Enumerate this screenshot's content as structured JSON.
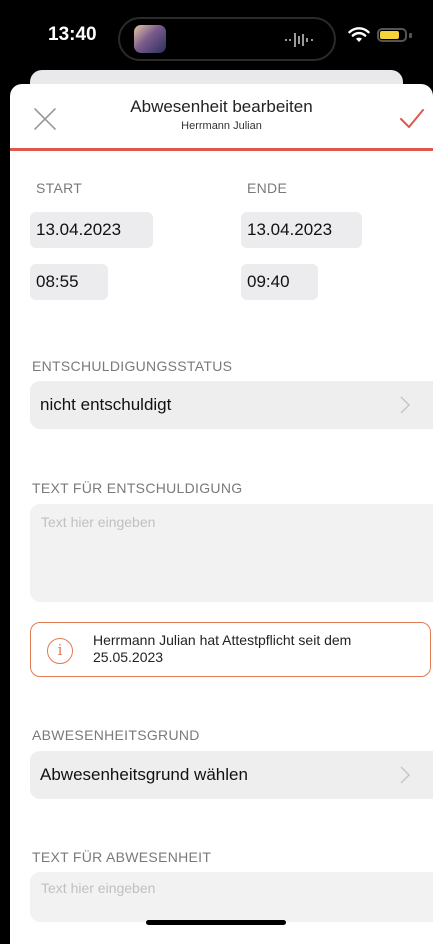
{
  "status_bar": {
    "time": "13:40"
  },
  "nav": {
    "title": "Abwesenheit bearbeiten",
    "subtitle": "Herrmann Julian"
  },
  "colors": {
    "accent": "#e0584c",
    "info_border": "#e07b54",
    "battery": "#f5d33a"
  },
  "start": {
    "label": "START",
    "date": "13.04.2023",
    "time": "08:55"
  },
  "end": {
    "label": "ENDE",
    "date": "13.04.2023",
    "time": "09:40"
  },
  "excuse_status": {
    "label": "ENTSCHULDIGUNGSSTATUS",
    "value": "nicht entschuldigt"
  },
  "excuse_text": {
    "label": "TEXT FÜR ENTSCHULDIGUNG",
    "placeholder": "Text hier eingeben"
  },
  "info": {
    "text": "Herrmann Julian hat Attestpflicht seit dem 25.05.2023"
  },
  "absence_reason": {
    "label": "ABWESENHEITSGRUND",
    "value": "Abwesenheitsgrund wählen"
  },
  "absence_text": {
    "label": "TEXT FÜR ABWESENHEIT",
    "placeholder": "Text hier eingeben"
  }
}
